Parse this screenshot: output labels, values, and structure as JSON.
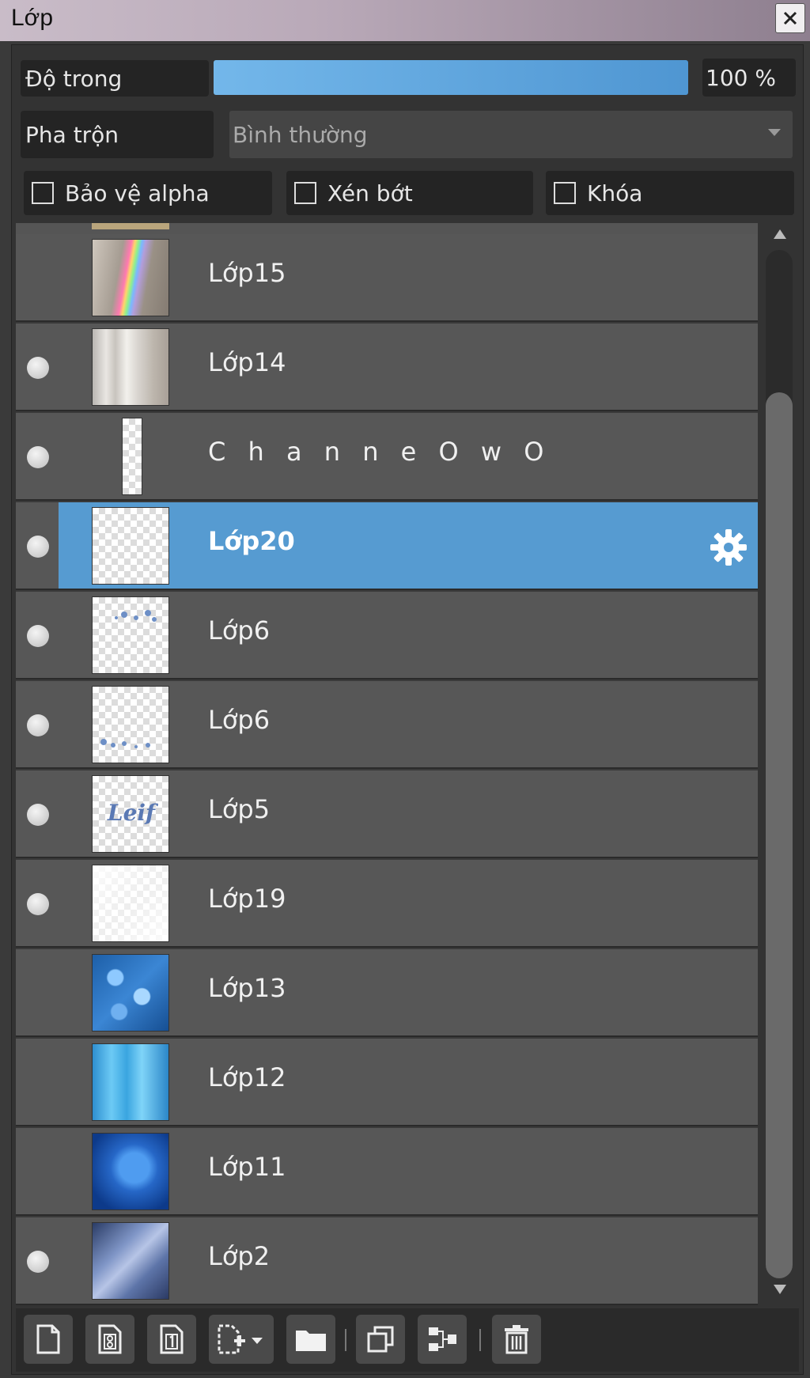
{
  "window": {
    "title": "Lớp"
  },
  "controls": {
    "opacity_label": "Độ trong",
    "opacity_value": "100 %",
    "opacity_fraction": 1.0,
    "blend_label": "Pha trộn",
    "blend_mode": "Bình thường",
    "protect_alpha_label": "Bảo vệ alpha",
    "clip_label": "Xén bớt",
    "lock_label": "Khóa"
  },
  "layers": [
    {
      "name": "Lớp15",
      "visible": false,
      "selected": false
    },
    {
      "name": "Lớp14",
      "visible": true,
      "selected": false
    },
    {
      "name": "C h a n n e O w O",
      "visible": true,
      "selected": false
    },
    {
      "name": "Lớp20",
      "visible": true,
      "selected": true
    },
    {
      "name": "Lớp6",
      "visible": true,
      "selected": false
    },
    {
      "name": "Lớp6",
      "visible": true,
      "selected": false
    },
    {
      "name": "Lớp5",
      "visible": true,
      "selected": false
    },
    {
      "name": "Lớp19",
      "visible": true,
      "selected": false
    },
    {
      "name": "Lớp13",
      "visible": false,
      "selected": false
    },
    {
      "name": "Lớp12",
      "visible": false,
      "selected": false
    },
    {
      "name": "Lớp11",
      "visible": false,
      "selected": false
    },
    {
      "name": "Lớp2",
      "visible": true,
      "selected": false
    }
  ],
  "thumb_text": {
    "lop5": "Leif"
  },
  "toolbar": {
    "buttons": [
      "new-layer-icon",
      "new-8bit-layer-icon",
      "new-1bit-layer-icon",
      "add-layer-menu-icon",
      "new-folder-icon",
      "duplicate-layer-icon",
      "merge-layer-icon",
      "delete-layer-icon"
    ]
  },
  "colors": {
    "selection": "#569bd1",
    "row": "#575757",
    "opacity_fill": "#5fa6df"
  }
}
